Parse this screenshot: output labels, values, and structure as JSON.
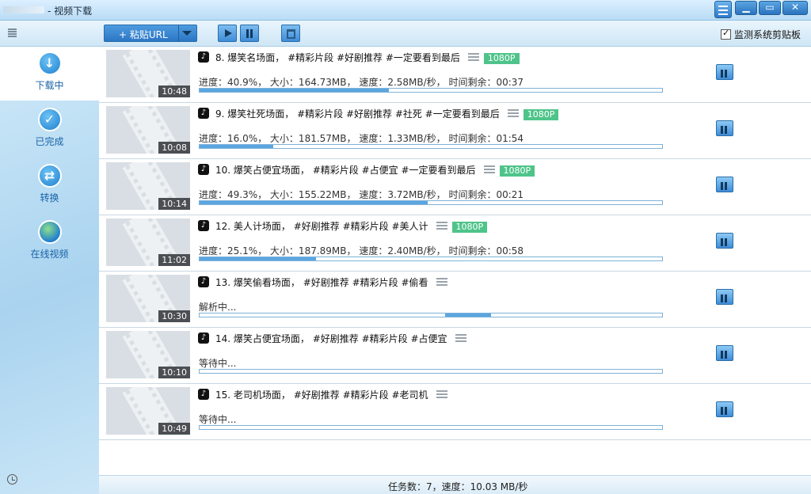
{
  "window": {
    "title": "- 视频下载"
  },
  "toolbar": {
    "paste_label": "+ 粘贴URL",
    "monitor_label": "监测系统剪贴板",
    "monitor_checked": true
  },
  "sidebar": {
    "items": [
      {
        "label": "下载中",
        "icon": "download-icon",
        "active": true
      },
      {
        "label": "已完成",
        "icon": "check-icon",
        "active": false
      },
      {
        "label": "转换",
        "icon": "convert-icon",
        "active": false
      },
      {
        "label": "在线视频",
        "icon": "globe-icon",
        "active": false
      }
    ]
  },
  "tasks": [
    {
      "duration": "10:48",
      "title": "8. 爆笑名场面， #精彩片段  #好剧推荐  #一定要看到最后",
      "quality": "1080P",
      "info": "进度：40.9%， 大小：164.73MB， 速度：2.58MB/秒， 时间剩余：00:37",
      "progress": 0.409
    },
    {
      "duration": "10:08",
      "title": "9. 爆笑社死场面，  #精彩片段  #好剧推荐  #社死  #一定要看到最后",
      "quality": "1080P",
      "info": "进度：16.0%， 大小：181.57MB， 速度：1.33MB/秒， 时间剩余：01:54",
      "progress": 0.16
    },
    {
      "duration": "10:14",
      "title": "10. 爆笑占便宜场面，  #精彩片段  #占便宜  #一定要看到最后",
      "quality": "1080P",
      "info": "进度：49.3%， 大小：155.22MB， 速度：3.72MB/秒， 时间剩余：00:21",
      "progress": 0.493
    },
    {
      "duration": "11:02",
      "title": "12. 美人计场面， #好剧推荐 #精彩片段 #美人计",
      "quality": "1080P",
      "info": "进度：25.1%， 大小：187.89MB， 速度：2.40MB/秒， 时间剩余：00:58",
      "progress": 0.251
    },
    {
      "duration": "10:30",
      "title": "13. 爆笑偷看场面， #好剧推荐 #精彩片段 #偷看",
      "quality": "",
      "info": "解析中...",
      "progress": 0.1
    },
    {
      "duration": "10:10",
      "title": "14. 爆笑占便宜场面， #好剧推荐 #精彩片段 #占便宜",
      "quality": "",
      "info": "等待中...",
      "progress": 0
    },
    {
      "duration": "10:49",
      "title": "15. 老司机场面， #好剧推荐 #精彩片段 #老司机",
      "quality": "",
      "info": "等待中...",
      "progress": 0
    }
  ],
  "status": {
    "text": "任务数：7，速度：10.03 MB/秒"
  }
}
